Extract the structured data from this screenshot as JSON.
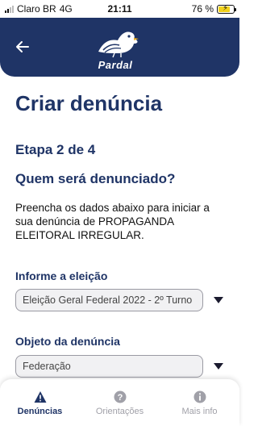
{
  "status_bar": {
    "carrier": "Claro BR",
    "network": "4G",
    "time": "21:11",
    "battery": "76 %",
    "battery_level": 0.76
  },
  "header": {
    "app_name": "Pardal",
    "back_icon": "arrow-left-icon",
    "logo_icon": "bird-icon"
  },
  "page": {
    "title": "Criar denúncia",
    "step": "Etapa 2 de 4",
    "question": "Quem será denunciado?",
    "description": "Preencha os dados abaixo para iniciar a sua denúncia de PROPAGANDA ELEITORAL IRREGULAR."
  },
  "form": {
    "election": {
      "label": "Informe a eleição",
      "value": "Eleição Geral Federal 2022 - 2º Turno"
    },
    "object": {
      "label": "Objeto da denúncia",
      "value": "Federação"
    }
  },
  "bottom_nav": {
    "items": [
      {
        "label": "Denúncias",
        "icon": "warning-triangle-icon",
        "active": true
      },
      {
        "label": "Orientações",
        "icon": "question-circle-icon",
        "active": false
      },
      {
        "label": "Mais info",
        "icon": "info-circle-icon",
        "active": false
      }
    ]
  },
  "colors": {
    "primary": "#1f3466",
    "inactive": "#a0a0a8",
    "battery": "#f3d21c"
  }
}
